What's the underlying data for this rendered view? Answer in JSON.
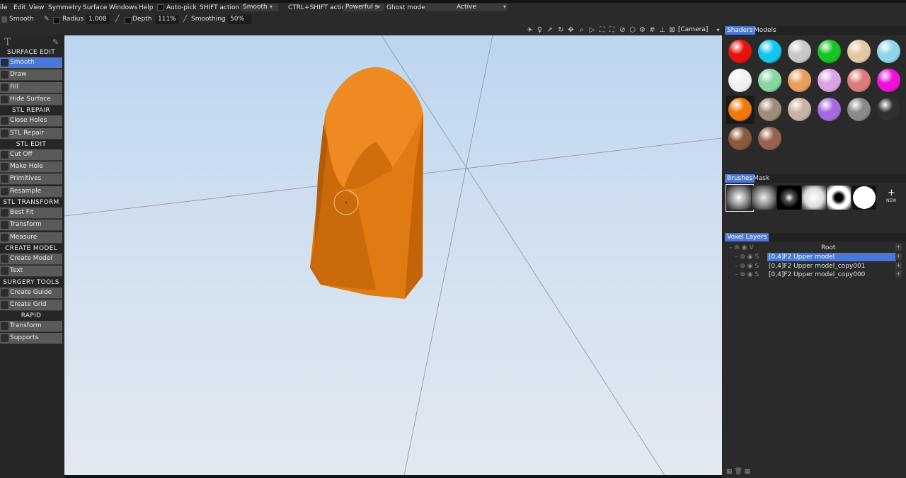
{
  "menu": {
    "items": [
      "ile",
      "Edit",
      "View",
      "Symmetry",
      "Surface",
      "Windows",
      "Help"
    ],
    "auto_pick": "Auto-pick",
    "shift_action": "SHIFT action",
    "shift_value": "Smooth",
    "ctrl_shift_action": "CTRL+SHIFT action",
    "ctrl_shift_value": "Powerful s",
    "ghost_mode_label": "Ghost mode:",
    "ghost_mode_value": "Active"
  },
  "options": {
    "tool_name": "Smooth",
    "radius_label": "Radius",
    "radius_value": "1,008",
    "depth_label": "Depth",
    "depth_value": "111%",
    "smoothing_label": "Smoothing",
    "smoothing_value": "50%",
    "camera_label": "[Camera]"
  },
  "left_panel": {
    "header_icon": "T",
    "sections": [
      {
        "title": "SURFACE EDIT",
        "tools": [
          "Smooth",
          "Draw",
          "Fill",
          "Hide Surface"
        ]
      },
      {
        "title": "STL REPAIR",
        "tools": [
          "Close Holes",
          "STL Repair"
        ]
      },
      {
        "title": "STL EDIT",
        "tools": [
          "Cut Off",
          "Make Hole",
          "Primitives",
          "Resample"
        ]
      },
      {
        "title": "STL TRANSFORM",
        "tools": [
          "Best Fit",
          "Transform",
          "Measure"
        ]
      },
      {
        "title": "CREATE MODEL",
        "tools": [
          "Create Model",
          "Text"
        ]
      },
      {
        "title": "SURGERY TOOLS",
        "tools": [
          "Create Guide",
          "Create Grid"
        ]
      },
      {
        "title": "RAPID PROTOTYPING",
        "tools": [
          "Transform",
          "Supports"
        ]
      }
    ],
    "active_tool": "Smooth"
  },
  "shaders": {
    "tab_active": "Shaders",
    "tab_other": "Models",
    "colors": [
      "#e8120c",
      "#13c6f0",
      "#c8c8c8",
      "#16c424",
      "#e4c8a2",
      "#8ed6ea",
      "#f2f2f2",
      "#88d6a4",
      "#e8a05a",
      "#dca2e6",
      "#dc7c7c",
      "#f010d8",
      "#f07808",
      "#a08c78",
      "#c8b4a4",
      "#a868e0",
      "#8a8a8a",
      "#303030",
      "#8a5a3a",
      "#9a6050"
    ]
  },
  "brushes": {
    "tab_active": "Brushes",
    "tab_other": "Mask",
    "new_label": "NEW"
  },
  "voxel_layers": {
    "title": "Voxel Layers",
    "root": "Root",
    "layers": [
      "[0,4]F2 Upper model",
      "[0,4]F2 Upper model_copy001",
      "[0,4]F2 Upper model_copy000"
    ],
    "selected_index": 0
  },
  "model_color": "#e07a12"
}
